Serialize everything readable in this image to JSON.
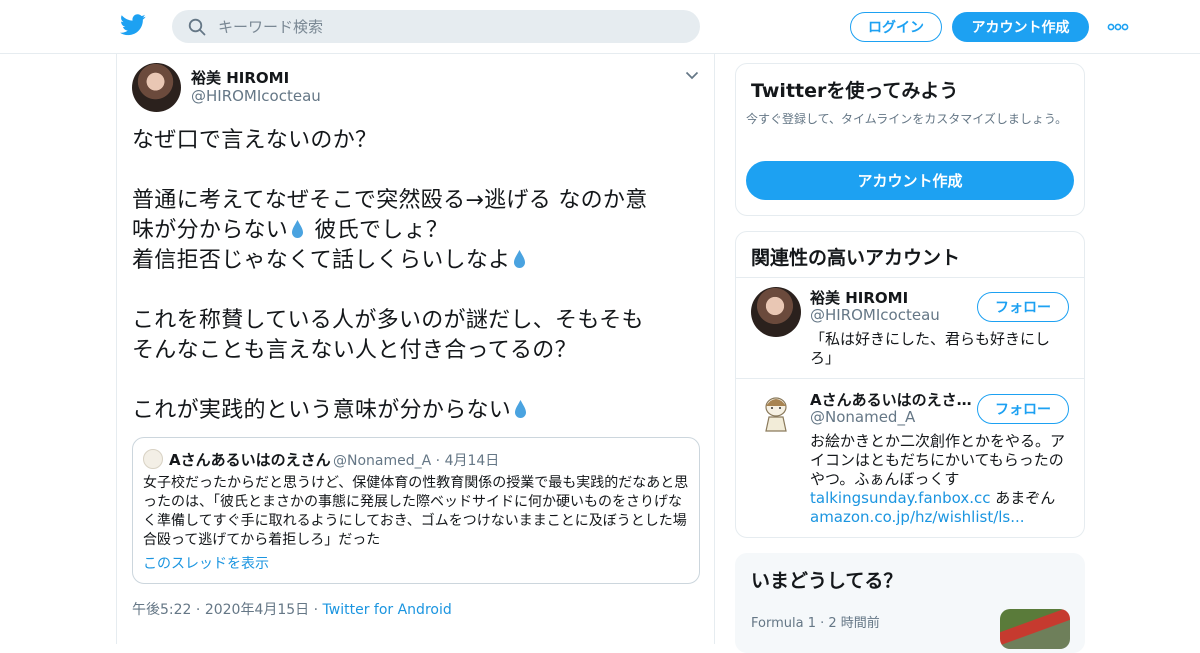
{
  "header": {
    "search_placeholder": "キーワード検索",
    "login_label": "ログイン",
    "signup_label": "アカウント作成",
    "brand_color": "#1da1f2"
  },
  "tweet": {
    "author_name": "裕美 HIROMI",
    "author_handle": "@HIROMIcocteau",
    "lines": [
      "なぜ口で言えないのか？",
      "",
      "普通に考えてなぜそこで突然殴る→逃げる なのか意",
      "味が分からない",
      " 彼氏でしょ？",
      "着信拒否じゃなくて話しくらいしなよ",
      "",
      "これを称賛している人が多いのが謎だし、そもそも",
      "そんなことも言えない人と付き合ってるの？",
      "",
      "これが実践的という意味が分からない"
    ],
    "quote": {
      "name": "Aさんあるいはのえさん",
      "handle": "@Nonamed_A",
      "date": "4月14日",
      "text": "女子校だったからだと思うけど、保健体育の性教育関係の授業で最も実践的だなあと思ったのは、「彼氏とまさかの事態に発展した際ベッドサイドに何か硬いものをさりげなく準備してすぐ手に取れるようにしておき、ゴムをつけないままことに及ぼうとした場合殴って逃げてから着拒しろ」だった",
      "thread_link": "このスレッドを表示"
    },
    "time": "午後5:22",
    "date": "2020年4月15日",
    "source": "Twitter for Android"
  },
  "sidebar": {
    "signup_card": {
      "title": "Twitterを使ってみよう",
      "subtitle": "今すぐ登録して、タイムラインをカスタマイズしましょう。",
      "button": "アカウント作成"
    },
    "related_card": {
      "title": "関連性の高いアカウント",
      "accounts": [
        {
          "name": "裕美 HIROMI",
          "handle": "@HIROMIcocteau",
          "bio": "「私は好きにした、君らも好きにしろ」",
          "follow": "フォロー"
        },
        {
          "name": "Aさんあるいはのえさ…",
          "handle": "@Nonamed_A",
          "bio_text": "お絵かきとか二次創作とかをやる。アイコンはともだちにかいてもらったのやつ。ふぁんぼっくす",
          "bio_link1": "talkingsunday.fanbox.cc",
          "bio_mid": " あまぞん",
          "bio_link2": "amazon.co.jp/hz/wishlist/ls...",
          "follow": "フォロー"
        }
      ]
    },
    "trends_card": {
      "title": "いまどうしてる？",
      "item_category": "Formula 1",
      "item_time": "2 時間前"
    }
  }
}
